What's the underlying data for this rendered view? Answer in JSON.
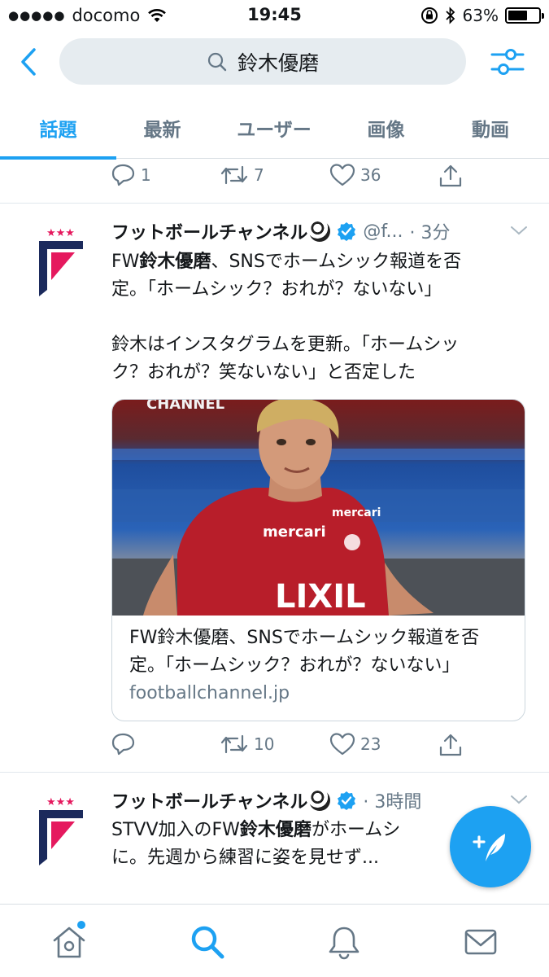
{
  "status_bar": {
    "signal_dots": "●●●●●",
    "carrier": "docomo",
    "time": "19:45",
    "battery_text": "63%",
    "battery_level": 0.63
  },
  "search": {
    "query": "鈴木優磨"
  },
  "tabs": [
    {
      "label": "話題",
      "active": true
    },
    {
      "label": "最新",
      "active": false
    },
    {
      "label": "ユーザー",
      "active": false
    },
    {
      "label": "画像",
      "active": false
    },
    {
      "label": "動画",
      "active": false
    }
  ],
  "prev_tweet_actions": {
    "replies": "1",
    "retweets": "7",
    "likes": "36"
  },
  "tweet1": {
    "name": "フットボールチャンネル",
    "handle": "@f...",
    "time": "· 3分",
    "text_line1_pre": "FW",
    "text_line1_bold": "鈴木優磨",
    "text_line1_post": "、SNSでホームシック報道を否",
    "text_line2": "定。「ホームシック？おれが？ないない」",
    "text_line3": "鈴木はインスタグラムを更新。「ホームシッ",
    "text_line4": "ク？おれが？笑ないない」と否定した",
    "card_image_caption": "CHANNEL",
    "card_title": "FW鈴木優磨、SNSでホームシック報道を否定。「ホームシック？おれが？ないない」",
    "card_domain": "footballchannel.jp",
    "replies": "",
    "retweets": "10",
    "likes": "23"
  },
  "tweet2": {
    "name": "フットボールチャンネル",
    "time": "· 3時間",
    "text_pre": "STVV加入のFW",
    "text_bold": "鈴木優磨",
    "text_post": "がホームシ",
    "text_line2": "に。先週から練習に姿を見せず..."
  },
  "colors": {
    "accent": "#1da1f2",
    "text": "#14171a",
    "muted": "#657786"
  }
}
